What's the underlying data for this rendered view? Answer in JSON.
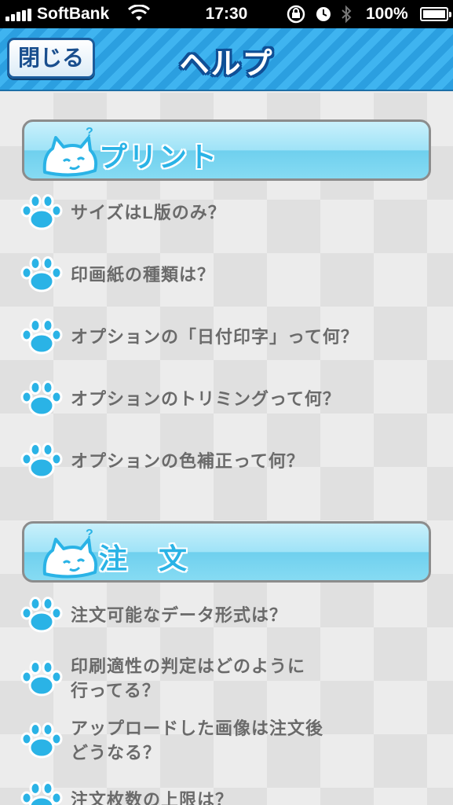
{
  "status_bar": {
    "carrier": "SoftBank",
    "time": "17:30",
    "battery": "100%"
  },
  "nav": {
    "close_label": "閉じる",
    "title": "ヘルプ"
  },
  "sections": [
    {
      "title": "プリント",
      "items": [
        "サイズはL版のみ？",
        "印画紙の種類は？",
        "オプションの「日付印字」って何？",
        "オプションのトリミングって何？",
        "オプションの色補正って何？"
      ]
    },
    {
      "title": "注　文",
      "items": [
        "注文可能なデータ形式は？",
        "印刷適性の判定はどのように\n行ってる？",
        "アップロードした画像は注文後\nどうなる？",
        "注文枚数の上限は？"
      ]
    }
  ],
  "colors": {
    "nav_stripe_dark": "#2b9fe0",
    "nav_stripe_light": "#3fb4f0",
    "accent_blue": "#2ab3e6",
    "text_gray": "#6a6a6a"
  },
  "icons": {
    "cat": "cat-question-icon",
    "paw": "paw-icon"
  }
}
